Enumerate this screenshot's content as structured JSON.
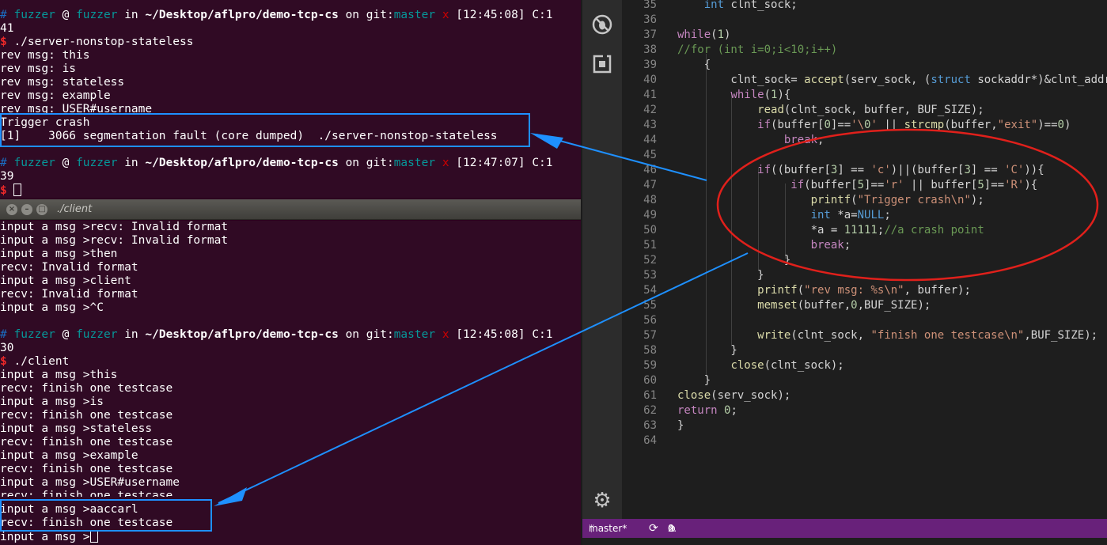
{
  "server_terminal": {
    "prompt1": {
      "hash": "#",
      "user": "fuzzer",
      "at": "@",
      "host": "fuzzer",
      "in": "in",
      "path": "~/Desktop/aflpro/demo-tcp-cs",
      "on": "on",
      "git": "git:",
      "branch": "master",
      "x": "x",
      "time": "[12:45:08]",
      "code": "C:1",
      "code_cont": "41"
    },
    "command": "./server-nonstop-stateless",
    "dollar": "$",
    "output": [
      "rev msg: this",
      "rev msg: is",
      "rev msg: stateless",
      "rev msg: example",
      "rev msg: USER#username"
    ],
    "crash_lines": [
      "Trigger crash",
      "[1]    3066 segmentation fault (core dumped)  ./server-nonstop-stateless"
    ],
    "prompt2": {
      "time": "[12:47:07]",
      "code": "C:1",
      "code_cont": "39"
    }
  },
  "client_window": {
    "title": "./client",
    "early_output": [
      "input a msg >recv: Invalid format",
      "input a msg >recv: Invalid format",
      "input a msg >then",
      "recv: Invalid format",
      "input a msg >client",
      "recv: Invalid format",
      "input a msg >^C"
    ],
    "prompt": {
      "time": "[12:45:08]",
      "code": "C:1",
      "code_cont": "30"
    },
    "command": "./client",
    "session": [
      "input a msg >this",
      "recv: finish one testcase",
      "input a msg >is",
      "recv: finish one testcase",
      "input a msg >stateless",
      "recv: finish one testcase",
      "input a msg >example",
      "recv: finish one testcase",
      "input a msg >USER#username",
      "recv: finish one testcase"
    ],
    "highlighted": [
      "input a msg >aaccarl",
      "recv: finish one testcase"
    ],
    "last_prompt": "input a msg >"
  },
  "editor": {
    "line_numbers": [
      "35",
      "36",
      "37",
      "38",
      "39",
      "40",
      "41",
      "42",
      "43",
      "44",
      "45",
      "46",
      "47",
      "48",
      "49",
      "50",
      "51",
      "52",
      "53",
      "54",
      "55",
      "56",
      "57",
      "58",
      "59",
      "60",
      "61",
      "62",
      "63",
      "64"
    ],
    "code_lines": [
      "    int clnt_sock;",
      "",
      "while(1)",
      "//for (int i=0;i<10;i++)",
      "    {",
      "        clnt_sock= accept(serv_sock, (struct sockaddr*)&clnt_addr",
      "        while(1){",
      "            read(clnt_sock, buffer, BUF_SIZE);",
      "            if(buffer[0]=='\\0' || strcmp(buffer,\"exit\")==0)",
      "                break;",
      "",
      "            if((buffer[3] == 'c')||(buffer[3] == 'C')){",
      "                 if(buffer[5]=='r' || buffer[5]=='R'){",
      "                    printf(\"Trigger crash\\n\");",
      "                    int *a=NULL;",
      "                    *a = 11111;//a crash point",
      "                    break;",
      "                }",
      "            }",
      "            printf(\"rev msg: %s\\n\", buffer);",
      "            memset(buffer,0,BUF_SIZE);",
      "",
      "            write(clnt_sock, \"finish one testcase\\n\",BUF_SIZE);",
      "        }",
      "        close(clnt_sock);",
      "    }",
      "close(serv_sock);",
      "return 0;",
      "}",
      ""
    ]
  },
  "statusbar": {
    "branch": "master*",
    "sync": "⟳",
    "errors": "0",
    "warnings": "0"
  },
  "icons": {
    "activity_top": "debug-icon",
    "activity_ext": "extensions-icon",
    "activity_bottom": "gear-icon"
  },
  "colors": {
    "highlight_box": "#1e90ff",
    "ellipse": "#e0201b",
    "statusbar": "#68217a",
    "terminal_bg": "#300a24"
  }
}
